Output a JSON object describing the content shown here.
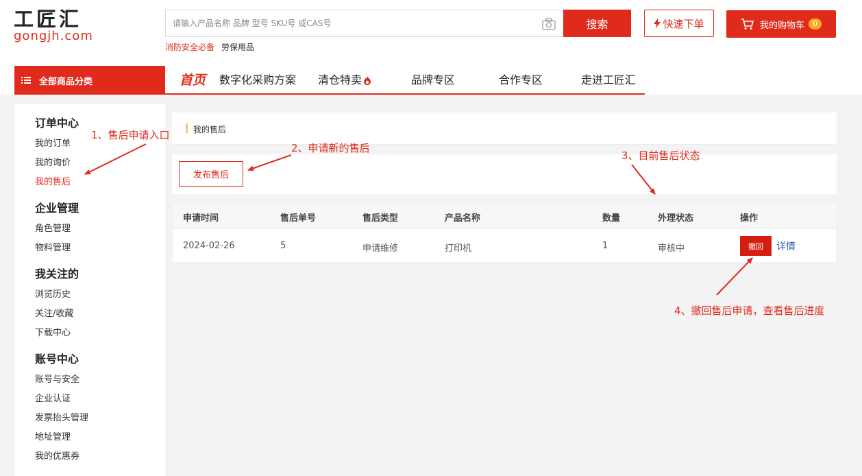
{
  "logo": {
    "cn": "工匠汇",
    "en": "gongjh.com"
  },
  "search": {
    "placeholder": "请输入产品名称 品牌 型号 SKU号 或CAS号",
    "button_label": "搜索",
    "hot_links": [
      "消防安全必备",
      "劳保用品"
    ]
  },
  "header": {
    "quick_order_label": "快速下单",
    "cart_label": "我的购物车",
    "cart_count": "0"
  },
  "nav": {
    "category_label": "全部商品分类",
    "items": [
      "首页",
      "数字化采购方案",
      "清仓特卖",
      "品牌专区",
      "合作专区",
      "走进工匠汇"
    ]
  },
  "sidebar": {
    "groups": [
      {
        "title": "订单中心",
        "links": [
          "我的订单",
          "我的询价",
          "我的售后"
        ]
      },
      {
        "title": "企业管理",
        "links": [
          "角色管理",
          "物料管理"
        ]
      },
      {
        "title": "我关注的",
        "links": [
          "浏览历史",
          "关注/收藏",
          "下载中心"
        ]
      },
      {
        "title": "账号中心",
        "links": [
          "账号与安全",
          "企业认证",
          "发票抬头管理",
          "地址管理",
          "我的优惠券"
        ]
      }
    ]
  },
  "breadcrumb": "我的售后",
  "publish_button": "发布售后",
  "table": {
    "headers": [
      "申请时间",
      "售后单号",
      "售后类型",
      "产品名称",
      "数量",
      "外理状态",
      "操作"
    ],
    "rows": [
      {
        "date": "2024-02-26",
        "id": "5",
        "type": "申请维修",
        "product": "打印机",
        "qty": "1",
        "status": "审核中",
        "revoke": "撤回",
        "detail": "详情"
      }
    ]
  },
  "annotations": {
    "a1": "1、售后申请入口",
    "a2": "2、申请新的售后",
    "a3": "3、目前售后状态",
    "a4": "4、撤回售后申请，查看售后进度"
  },
  "colors": {
    "brand": "#e02b1c",
    "link": "#2b62b8",
    "accent_bar": "#f5c27b",
    "badge": "#ffab21"
  }
}
